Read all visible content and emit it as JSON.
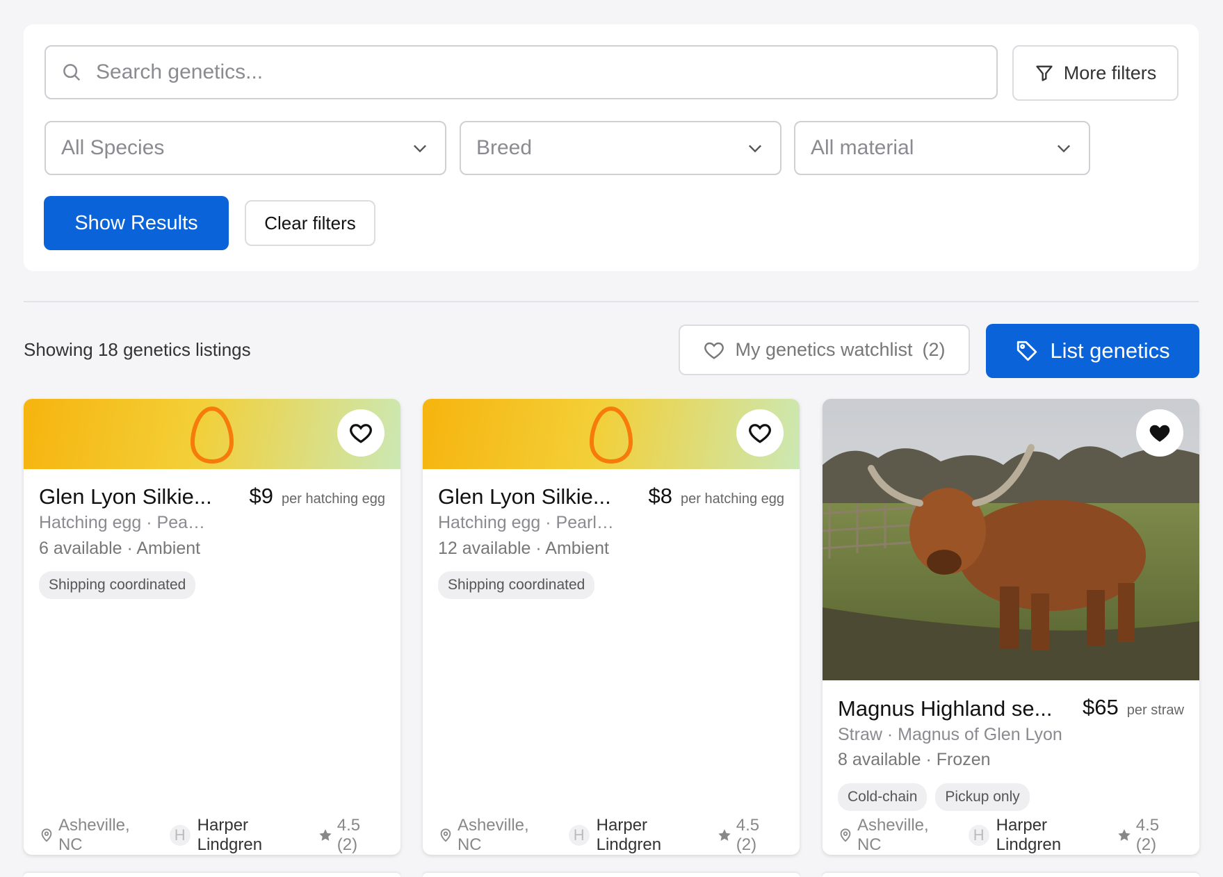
{
  "search": {
    "placeholder": "Search genetics..."
  },
  "filters": {
    "more_label": "More filters",
    "species": "All Species",
    "breed": "Breed",
    "material": "All material",
    "show_results": "Show Results",
    "clear": "Clear filters"
  },
  "results": {
    "showing": "Showing 18 genetics listings",
    "watchlist_label": "My genetics watchlist",
    "watchlist_count": "(2)",
    "list_label": "List genetics"
  },
  "colors": {
    "primary": "#0b63d9",
    "egg": "#f77b0a"
  },
  "cards": [
    {
      "title": "Glen Lyon Silkie...",
      "price": "$9",
      "unit": "per hatching egg",
      "subtitle": "Hatching egg · Pearl ...",
      "availability": "6 available · Ambient",
      "tags": [
        "Shipping coordinated"
      ],
      "location": "Asheville, NC",
      "avatar": "H",
      "seller": "Harper Lindgren",
      "rating": "4.5 (2)",
      "favorited": false,
      "image": "egg-icon"
    },
    {
      "title": "Glen Lyon Silkie...",
      "price": "$8",
      "unit": "per hatching egg",
      "subtitle": "Hatching egg · Pearl S...",
      "availability": "12 available · Ambient",
      "tags": [
        "Shipping coordinated"
      ],
      "location": "Asheville, NC",
      "avatar": "H",
      "seller": "Harper Lindgren",
      "rating": "4.5 (2)",
      "favorited": false,
      "image": "egg-icon"
    },
    {
      "title": "Magnus Highland se...",
      "price": "$65",
      "unit": "per straw",
      "subtitle": "Straw · Magnus of Glen Lyon",
      "availability": "8 available · Frozen",
      "tags": [
        "Cold-chain",
        "Pickup only"
      ],
      "location": "Asheville, NC",
      "avatar": "H",
      "seller": "Harper Lindgren",
      "rating": "4.5 (2)",
      "favorited": true,
      "image": "highland-cow-photo"
    }
  ]
}
